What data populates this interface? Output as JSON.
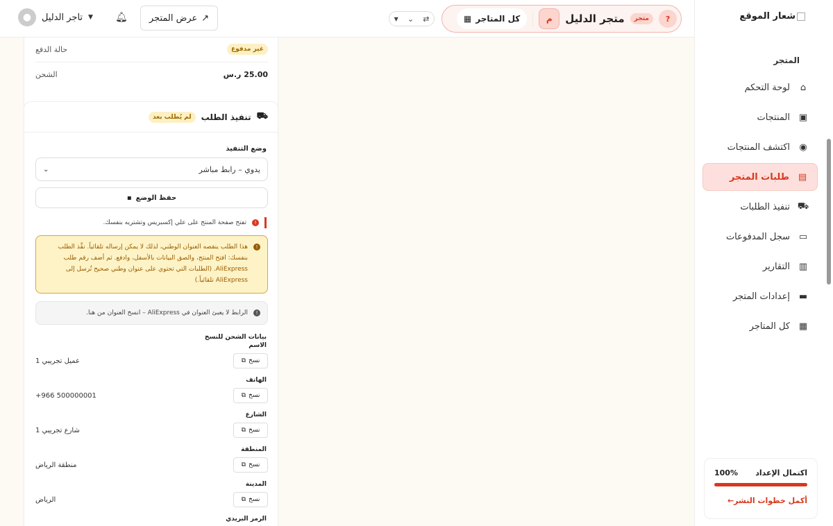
{
  "sidebar": {
    "logo_alt": "شعار الموقع",
    "section_label": "المتجر",
    "items": [
      {
        "label": "لوحة التحكم",
        "icon": "home-icon",
        "glyph": "⌂"
      },
      {
        "label": "المنتجات",
        "icon": "box-icon",
        "glyph": "▣"
      },
      {
        "label": "اكتشف المنتجات",
        "icon": "compass-icon",
        "glyph": "◉"
      },
      {
        "label": "طلبات المتجر",
        "icon": "receipt-icon",
        "glyph": "▤",
        "active": true
      },
      {
        "label": "تنفيذ الطلبات",
        "icon": "truck-icon",
        "glyph": "⛟"
      },
      {
        "label": "سجل المدفوعات",
        "icon": "money-icon",
        "glyph": "▭"
      },
      {
        "label": "التقارير",
        "icon": "chart-icon",
        "glyph": "▥"
      },
      {
        "label": "إعدادات المتجر",
        "icon": "store-icon",
        "glyph": "▬"
      },
      {
        "label": "كل المتاجر",
        "icon": "grid-icon",
        "glyph": "▦"
      }
    ],
    "setup": {
      "title": "اكتمال الإعداد",
      "percent_label": "100%",
      "progress": 1.0,
      "link": "أكمل خطوات النشر←"
    }
  },
  "topbar": {
    "all_stores": "كل المتاجر",
    "store_name": "متجر الدليل",
    "store_initial": "م",
    "store_badge": "متجر",
    "help": "?",
    "view_store": "عرض المتجر",
    "user_name": "تاجر الدليل"
  },
  "summary": {
    "payment_status_label": "حالة الدفع",
    "payment_status_value": "غير مدفوع",
    "shipping_label": "الشحن",
    "shipping_value": "25.00 ر.س"
  },
  "fulfillment": {
    "title": "تنفيذ الطلب",
    "status_badge": "لم يُطلب بعد",
    "mode_label": "وضع التنفيذ",
    "mode_value": "يدوي – رابط مباشر",
    "save_label": "حفظ الوضع",
    "hint": "تفتح صفحة المنتج على علي إكسبريس وتشتريه بنفسك.",
    "warning": "هذا الطلب ينقصه العنوان الوطني، لذلك لا يمكن إرساله تلقائياً. نفِّذ الطلب بنفسك: افتح المنتج، والصق البيانات بالأسفل، وادفع. ثم أضف رقم طلب AliExpress. (الطلبات التي تحتوي على عنوان وطني صحيح تُرسل إلى AliExpress تلقائياً.)",
    "info": "الرابط لا يعبئ العنوان في AliExpress – انسخ العنوان من هنا.",
    "shipping_section_title": "بيانات الشحن للنسخ",
    "copy_label": "نسخ",
    "fields": [
      {
        "label": "الاسم",
        "value": "عميل تجريبي 1"
      },
      {
        "label": "الهاتف",
        "value": "+966 500000001"
      },
      {
        "label": "الشارع",
        "value": "شارع تجريبي 1"
      },
      {
        "label": "المنطقة",
        "value": "منطقة الرياض"
      },
      {
        "label": "المدينة",
        "value": "الرياض"
      },
      {
        "label": "الرمز البريدي",
        "value": ""
      }
    ]
  }
}
